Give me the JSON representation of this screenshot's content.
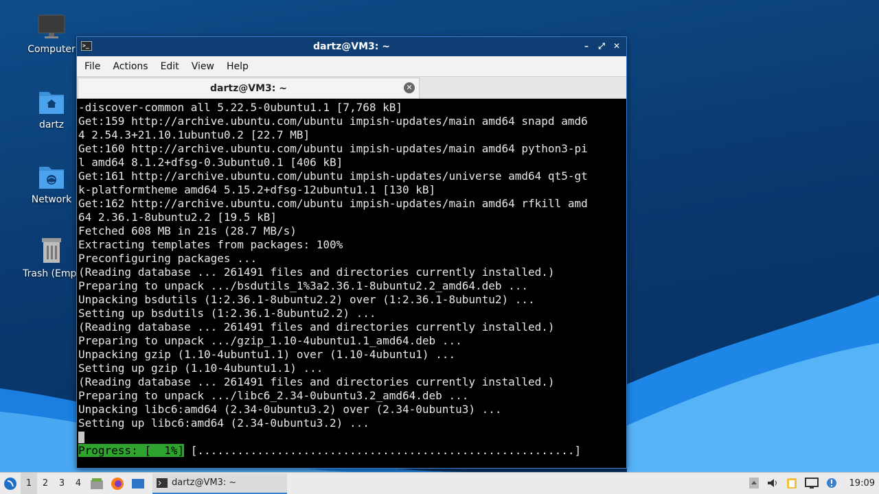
{
  "desktop": {
    "icons": [
      {
        "label": "Computer",
        "icon": "monitor-icon"
      },
      {
        "label": "dartz",
        "icon": "home-folder-icon"
      },
      {
        "label": "Network",
        "icon": "network-folder-icon"
      },
      {
        "label": "Trash (Empt",
        "icon": "trash-icon"
      }
    ]
  },
  "window": {
    "title": "dartz@VM3: ~",
    "controls": [
      "–",
      "⤢",
      "✕"
    ],
    "menu": [
      "File",
      "Actions",
      "Edit",
      "View",
      "Help"
    ],
    "tab_label": "dartz@VM3: ~",
    "terminal_lines": [
      "-discover-common all 5.22.5-0ubuntu1.1 [7,768 kB]",
      "Get:159 http://archive.ubuntu.com/ubuntu impish-updates/main amd64 snapd amd6",
      "4 2.54.3+21.10.1ubuntu0.2 [22.7 MB]",
      "Get:160 http://archive.ubuntu.com/ubuntu impish-updates/main amd64 python3-pi",
      "l amd64 8.1.2+dfsg-0.3ubuntu0.1 [406 kB]",
      "Get:161 http://archive.ubuntu.com/ubuntu impish-updates/universe amd64 qt5-gt",
      "k-platformtheme amd64 5.15.2+dfsg-12ubuntu1.1 [130 kB]",
      "Get:162 http://archive.ubuntu.com/ubuntu impish-updates/main amd64 rfkill amd",
      "64 2.36.1-8ubuntu2.2 [19.5 kB]",
      "Fetched 608 MB in 21s (28.7 MB/s)",
      "Extracting templates from packages: 100%",
      "Preconfiguring packages ...",
      "(Reading database ... 261491 files and directories currently installed.)",
      "Preparing to unpack .../bsdutils_1%3a2.36.1-8ubuntu2.2_amd64.deb ...",
      "Unpacking bsdutils (1:2.36.1-8ubuntu2.2) over (1:2.36.1-8ubuntu2) ...",
      "Setting up bsdutils (1:2.36.1-8ubuntu2.2) ...",
      "(Reading database ... 261491 files and directories currently installed.)",
      "Preparing to unpack .../gzip_1.10-4ubuntu1.1_amd64.deb ...",
      "Unpacking gzip (1.10-4ubuntu1.1) over (1.10-4ubuntu1) ...",
      "Setting up gzip (1.10-4ubuntu1.1) ...",
      "(Reading database ... 261491 files and directories currently installed.)",
      "Preparing to unpack .../libc6_2.34-0ubuntu3.2_amd64.deb ...",
      "Unpacking libc6:amd64 (2.34-0ubuntu3.2) over (2.34-0ubuntu3) ...",
      "Setting up libc6:amd64 (2.34-0ubuntu3.2) ..."
    ],
    "progress_label": "Progress: [  1%]",
    "progress_bar": " [.........................................................]"
  },
  "taskbar": {
    "workspaces": [
      "1",
      "2",
      "3",
      "4"
    ],
    "active_workspace": "1",
    "task_label": "dartz@VM3: ~",
    "clock": "19:09"
  },
  "colors": {
    "accent": "#3b7fd1",
    "titlebar": "#0e3e73",
    "progress_green": "#2ea32e"
  }
}
